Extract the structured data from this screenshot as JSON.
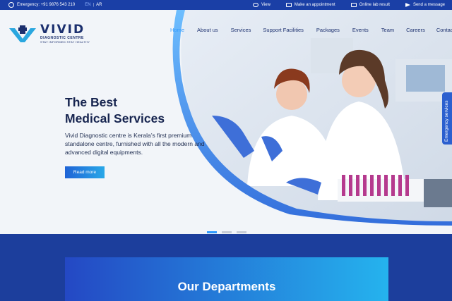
{
  "topbar": {
    "emergency": "Emergency: +91 9876 543 210",
    "lang_en": "EN",
    "lang_sep": "|",
    "lang_ar": "AR",
    "links": [
      {
        "label": "View",
        "icon": "eye-icon"
      },
      {
        "label": "Make an appointment",
        "icon": "calendar-icon"
      },
      {
        "label": "Online lab result",
        "icon": "document-icon"
      },
      {
        "label": "Send a message",
        "icon": "paper-plane-icon"
      }
    ]
  },
  "logo": {
    "name": "VIVID",
    "subtitle": "DIAGNOSTIC CENTRE",
    "tagline": "STAY INFORMED STAY HEALTHY"
  },
  "nav": {
    "items": [
      {
        "label": "Home",
        "active": true
      },
      {
        "label": "About us"
      },
      {
        "label": "Services"
      },
      {
        "label": "Support Facilities"
      },
      {
        "label": "Packages"
      },
      {
        "label": "Events"
      },
      {
        "label": "Team"
      },
      {
        "label": "Careers"
      },
      {
        "label": "Contact us"
      }
    ]
  },
  "hero": {
    "headline_line1": "The Best",
    "headline_line2": "Medical Services",
    "description": "Vivid Diagnostic centre is Kerala’s first premium standalone centre, furnished with all the modern and advanced digital equipments.",
    "cta": "Read more",
    "slides": 3,
    "active_slide": 1
  },
  "side_tab": {
    "label": "Emergency services"
  },
  "departments": {
    "title": "Our Departments"
  },
  "colors": {
    "brand_dark": "#1b2f6e",
    "accent": "#2f9bff",
    "topbar": "#1a3fa6",
    "section_bg": "#1c3e9c"
  }
}
